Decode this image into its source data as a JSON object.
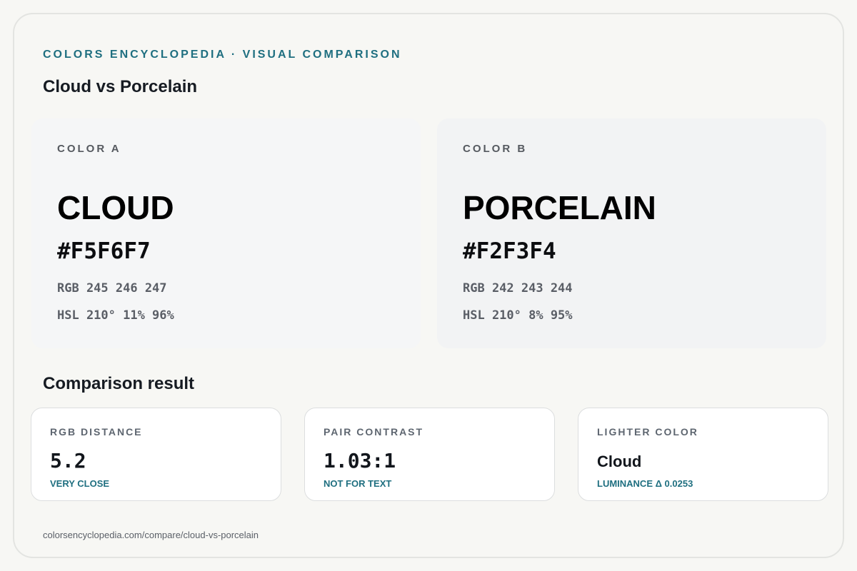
{
  "header": {
    "eyebrow": "COLORS ENCYCLOPEDIA · VISUAL COMPARISON",
    "title": "Cloud vs Porcelain"
  },
  "colors": {
    "a": {
      "tag": "COLOR A",
      "name": "CLOUD",
      "hex": "#F5F6F7",
      "rgb": "RGB 245 246 247",
      "hsl": "HSL 210° 11% 96%",
      "swatch_color": "#F5F6F7"
    },
    "b": {
      "tag": "COLOR B",
      "name": "PORCELAIN",
      "hex": "#F2F3F4",
      "rgb": "RGB 242 243 244",
      "hsl": "HSL 210° 8% 95%",
      "swatch_color": "#F2F3F4"
    }
  },
  "comparison": {
    "title": "Comparison result",
    "metrics": [
      {
        "label": "RGB DISTANCE",
        "value": "5.2",
        "note": "VERY CLOSE"
      },
      {
        "label": "PAIR CONTRAST",
        "value": "1.03:1",
        "note": "NOT FOR TEXT"
      },
      {
        "label": "LIGHTER COLOR",
        "value": "Cloud",
        "note": "LUMINANCE Δ 0.0253"
      }
    ]
  },
  "footer": {
    "url": "colorsencyclopedia.com/compare/cloud-vs-porcelain"
  },
  "theme": {
    "accent": "#1F6F80",
    "background": "#F7F7F4"
  }
}
